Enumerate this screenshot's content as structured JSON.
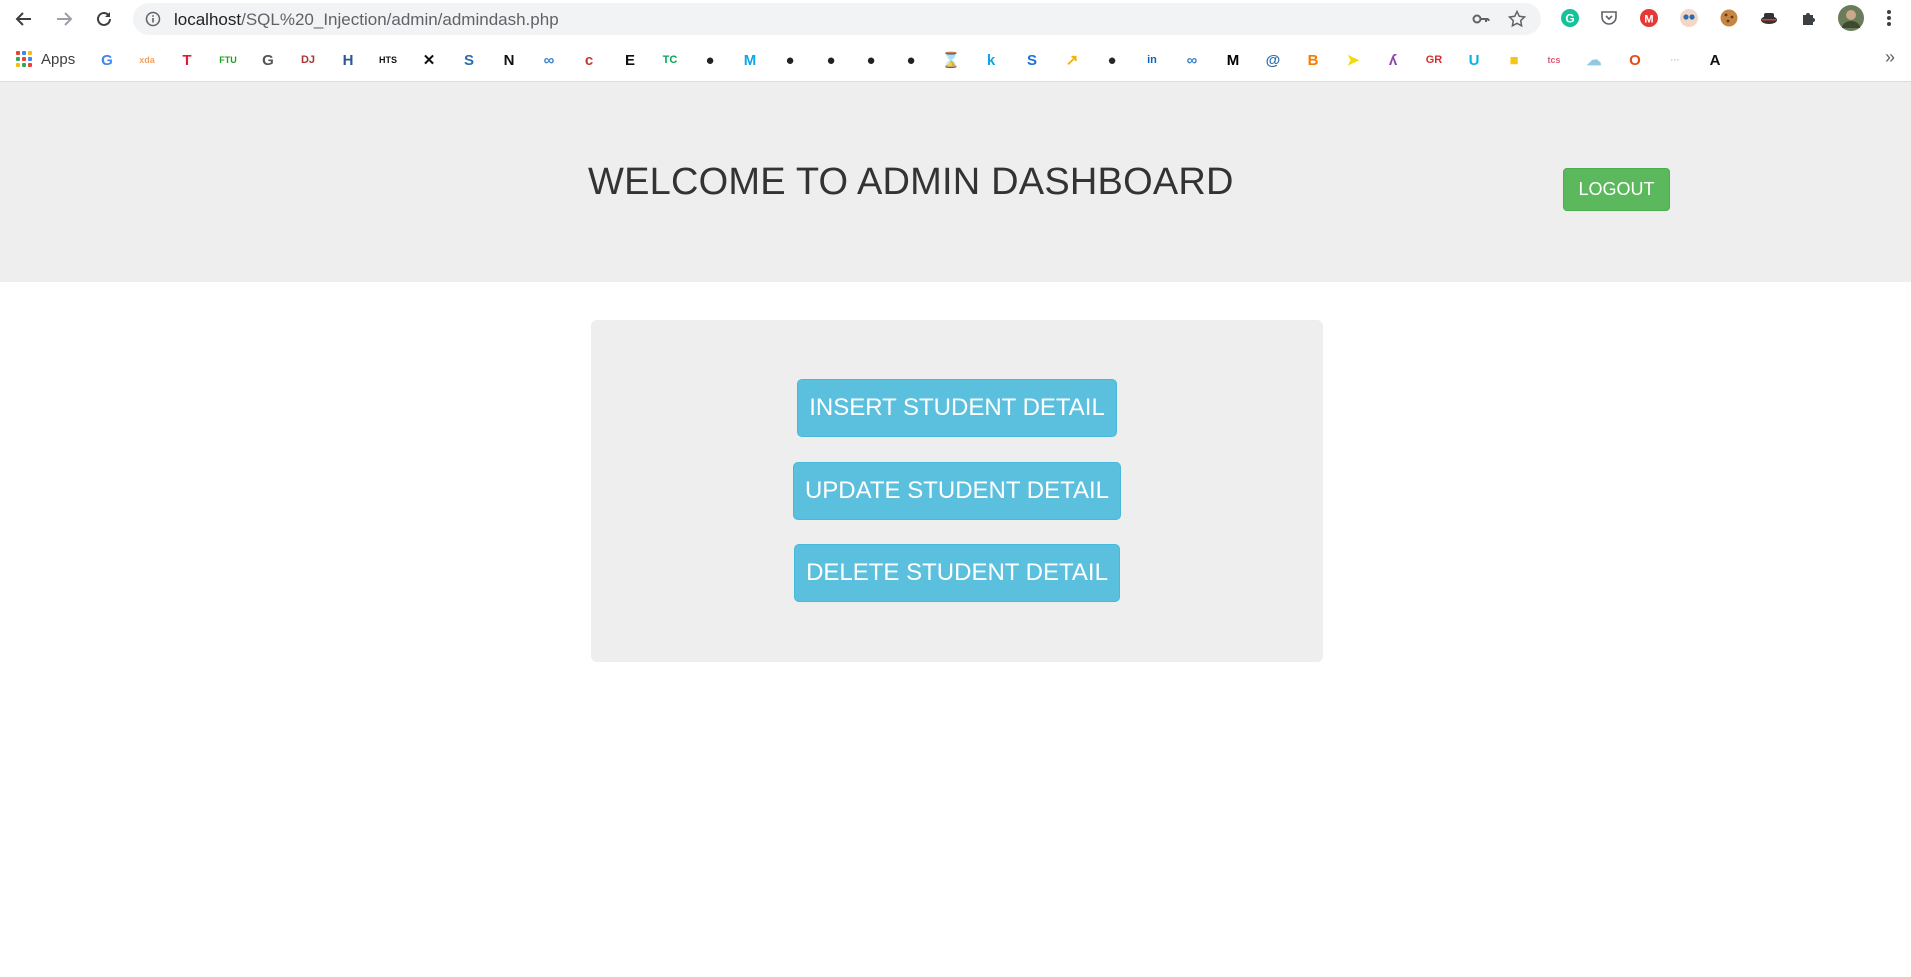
{
  "browser": {
    "url_host": "localhost",
    "url_path": "/SQL%20_Injection/admin/admindash.php",
    "apps_label": "Apps",
    "bookmarks": [
      {
        "icon": "google-icon",
        "glyph": "G",
        "color": "#4285f4"
      },
      {
        "icon": "xda-icon",
        "glyph": "xda",
        "color": "#f4a261"
      },
      {
        "icon": "tesla-icon",
        "glyph": "T",
        "color": "#e31937"
      },
      {
        "icon": "ftu-icon",
        "glyph": "FTU",
        "color": "#1aa01a"
      },
      {
        "icon": "goodreads-icon",
        "glyph": "G",
        "color": "#555555"
      },
      {
        "icon": "dj-icon",
        "glyph": "DJ",
        "color": "#a33"
      },
      {
        "icon": "h-icon",
        "glyph": "H",
        "color": "#2b5797"
      },
      {
        "icon": "hts-icon",
        "glyph": "HTS",
        "color": "#111111"
      },
      {
        "icon": "maze-icon",
        "glyph": "✕",
        "color": "#111111"
      },
      {
        "icon": "s-dots-icon",
        "glyph": "S",
        "color": "#2b6cb0"
      },
      {
        "icon": "n-icon",
        "glyph": "N",
        "color": "#111111"
      },
      {
        "icon": "infinity-icon",
        "glyph": "∞",
        "color": "#3b82c4"
      },
      {
        "icon": "cj-icon",
        "glyph": "c",
        "color": "#c0392b"
      },
      {
        "icon": "e-icon",
        "glyph": "E",
        "color": "#111111"
      },
      {
        "icon": "tc-icon",
        "glyph": "TC",
        "color": "#0aa55a"
      },
      {
        "icon": "globe-icon",
        "glyph": "●",
        "color": "#222222"
      },
      {
        "icon": "m-icon",
        "glyph": "M",
        "color": "#0ea5e9"
      },
      {
        "icon": "globe-icon",
        "glyph": "●",
        "color": "#222222"
      },
      {
        "icon": "globe-icon",
        "glyph": "●",
        "color": "#222222"
      },
      {
        "icon": "globe-icon",
        "glyph": "●",
        "color": "#222222"
      },
      {
        "icon": "globe-icon",
        "glyph": "●",
        "color": "#222222"
      },
      {
        "icon": "hourglass-icon",
        "glyph": "⌛",
        "color": "#f59e0b"
      },
      {
        "icon": "k-icon",
        "glyph": "k",
        "color": "#0ea5e9"
      },
      {
        "icon": "s-icon",
        "glyph": "S",
        "color": "#1d6fe0"
      },
      {
        "icon": "arrow-icon",
        "glyph": "↗",
        "color": "#f5b301"
      },
      {
        "icon": "github-icon",
        "glyph": "●",
        "color": "#24292e"
      },
      {
        "icon": "linkedin-icon",
        "glyph": "in",
        "color": "#0a66c2"
      },
      {
        "icon": "infinity-icon",
        "glyph": "∞",
        "color": "#3b82c4"
      },
      {
        "icon": "medium-icon",
        "glyph": "M",
        "color": "#000000"
      },
      {
        "icon": "at-icon",
        "glyph": "@",
        "color": "#2b6cb0"
      },
      {
        "icon": "blogger-icon",
        "glyph": "B",
        "color": "#f57c00"
      },
      {
        "icon": "send-icon",
        "glyph": "➤",
        "color": "#f5d90a"
      },
      {
        "icon": "hook-icon",
        "glyph": "ʎ",
        "color": "#8e44ad"
      },
      {
        "icon": "gr-icon",
        "glyph": "GR",
        "color": "#d32f2f"
      },
      {
        "icon": "udacity-icon",
        "glyph": "U",
        "color": "#02b3e4"
      },
      {
        "icon": "classroom-icon",
        "glyph": "■",
        "color": "#f5c518"
      },
      {
        "icon": "tcs-icon",
        "glyph": "tcs",
        "color": "#e05a7a"
      },
      {
        "icon": "cloud-icon",
        "glyph": "☁",
        "color": "#8ecae6"
      },
      {
        "icon": "office-icon",
        "glyph": "O",
        "color": "#e64a19"
      },
      {
        "icon": "dots-icon",
        "glyph": "···",
        "color": "#a5c8e4"
      },
      {
        "icon": "a-icon",
        "glyph": "A",
        "color": "#111111"
      }
    ]
  },
  "header": {
    "title": "WELCOME TO ADMIN DASHBOARD",
    "logout_label": "LOGOUT"
  },
  "actions": {
    "insert_label": "INSERT STUDENT DETAIL",
    "update_label": "UPDATE STUDENT DETAIL",
    "delete_label": "DELETE STUDENT DETAIL"
  },
  "colors": {
    "header_bg": "#eeeeee",
    "logout_bg": "#5cb85c",
    "action_bg": "#5bc0de"
  }
}
